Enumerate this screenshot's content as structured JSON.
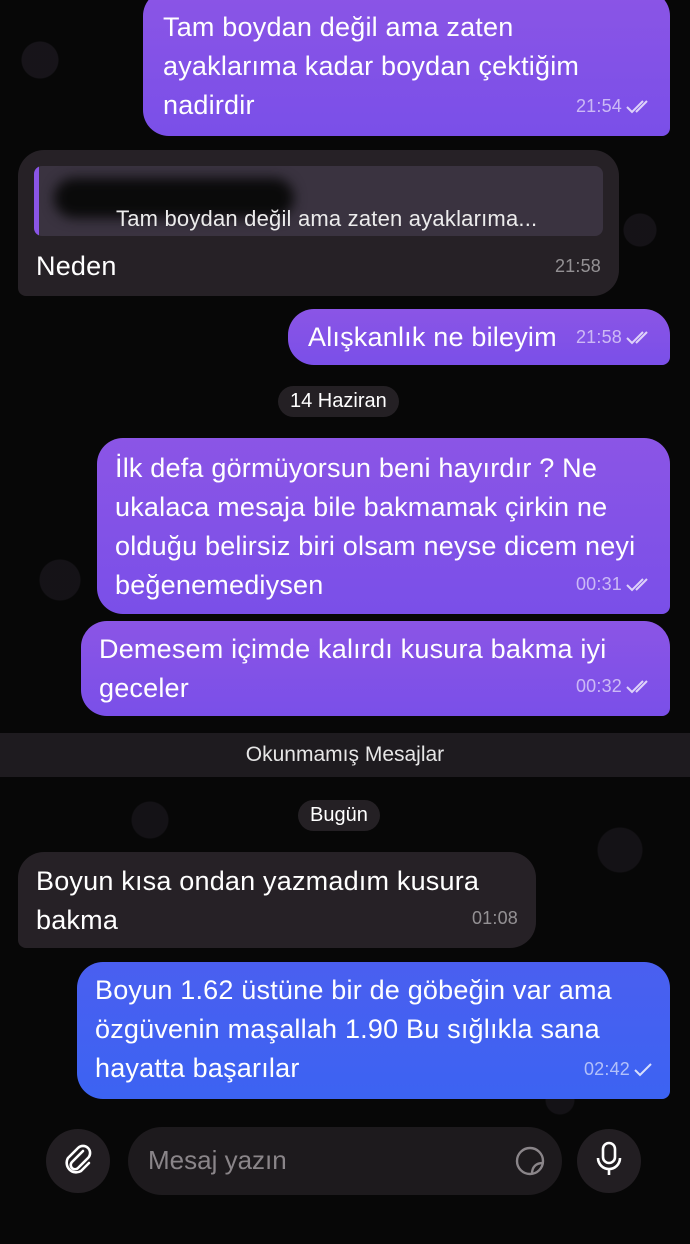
{
  "messages": [
    {
      "direction": "out",
      "text": "Tam boydan değil ama zaten ayaklarıma kadar boydan çektiğim nadirdir",
      "time": "21:54"
    },
    {
      "direction": "in",
      "reply_preview": "Tam boydan değil ama zaten ayaklarıma...",
      "text": "Neden",
      "time": "21:58"
    },
    {
      "direction": "out",
      "text": "Alışkanlık ne bileyim",
      "time": "21:58"
    },
    {
      "direction": "out",
      "text": "İlk defa görmüyorsun beni hayırdır ? Ne ukalaca mesaja bile bakmamak çirkin ne olduğu belirsiz biri olsam neyse dicem neyi beğenemediysen",
      "time": "00:31"
    },
    {
      "direction": "out",
      "text": "Demesem içimde kalırdı kusura bakma iyi geceler",
      "time": "00:32"
    },
    {
      "direction": "in",
      "text": "Boyun kısa ondan yazmadım kusura bakma",
      "time": "01:08"
    },
    {
      "direction": "out",
      "text": "Boyun 1.62 üstüne bir de göbeğin var ama özgüvenin maşallah 1.90 Bu sığlıkla sana hayatta başarılar",
      "time": "02:42",
      "status": "sent"
    }
  ],
  "separators": {
    "date_june": "14 Haziran",
    "unread": "Okunmamış Mesajlar",
    "today": "Bugün"
  },
  "composer": {
    "placeholder": "Mesaj yazın"
  },
  "colors": {
    "outgoing_purple": "#8b55e6",
    "outgoing_blue": "#4a5ff0",
    "incoming": "#262126",
    "background": "#070707"
  },
  "icons": {
    "attach": "paperclip-icon",
    "sticker": "sticker-icon",
    "mic": "microphone-icon",
    "read": "double-check-icon",
    "sent": "single-check-icon"
  }
}
